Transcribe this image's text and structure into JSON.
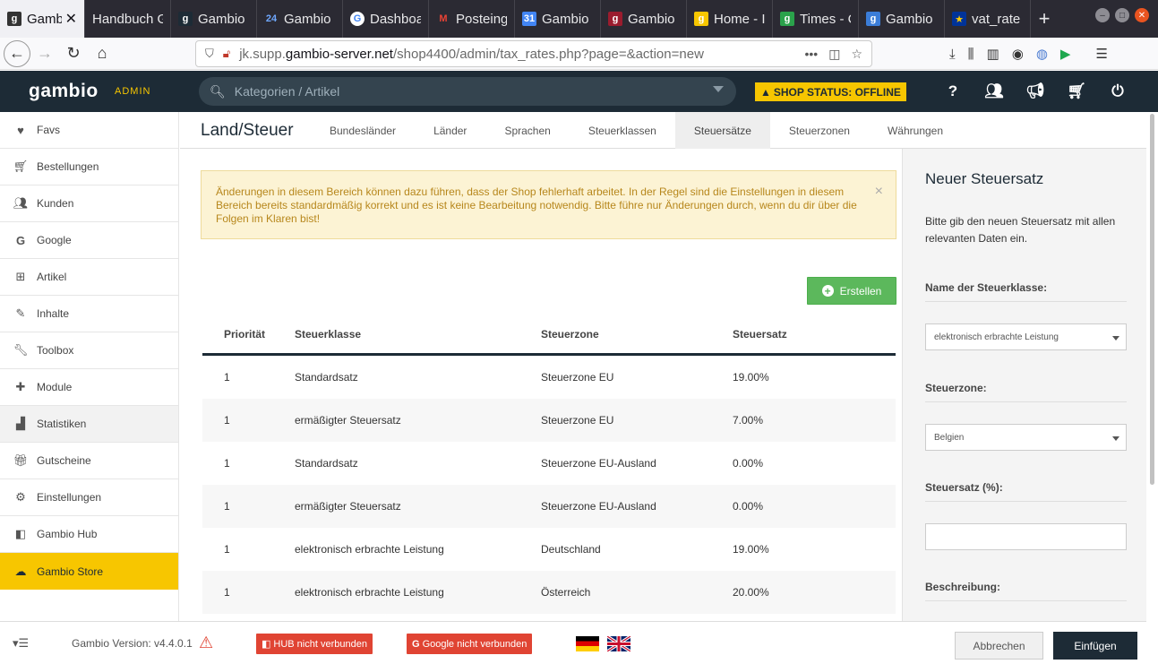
{
  "browser": {
    "tabs": [
      {
        "label": "Gambi",
        "fav": "g",
        "color": "#333"
      },
      {
        "label": "Handbuch G",
        "fav": "",
        "color": "#555"
      },
      {
        "label": "Gambio",
        "fav": "g",
        "color": "#1d2b36"
      },
      {
        "label": "Gambio",
        "fav": "24",
        "color": "#2c62b8"
      },
      {
        "label": "Dashboa",
        "fav": "G",
        "color": "#fff"
      },
      {
        "label": "Posteing",
        "fav": "M",
        "color": "#fff"
      },
      {
        "label": "Gambio",
        "fav": "31",
        "color": "#4285f4"
      },
      {
        "label": "Gambio",
        "fav": "g",
        "color": "#9b1c2e"
      },
      {
        "label": "Home - I",
        "fav": "g",
        "color": "#f7c600"
      },
      {
        "label": "Times - C",
        "fav": "g",
        "color": "#2aa24b"
      },
      {
        "label": "Gambio",
        "fav": "g",
        "color": "#3b7dd8"
      },
      {
        "label": "vat_rate",
        "fav": "★",
        "color": "#003399"
      }
    ],
    "url_prefix": "jk.supp.",
    "url_domain": "gambio-server.net",
    "url_path": "/shop4400/admin/tax_rates.php?page=&action=new",
    "url_ellipsis": "•••"
  },
  "header": {
    "logo": "gambio",
    "logo_sub": "ADMIN",
    "search_placeholder": "Kategorien / Artikel",
    "shop_status": "SHOP STATUS: OFFLINE",
    "icons": [
      "help-icon",
      "users-icon",
      "megaphone-icon",
      "cart-icon",
      "power-icon"
    ]
  },
  "sidebar": {
    "items": [
      {
        "label": "Favs",
        "icon": "♥"
      },
      {
        "label": "Bestellungen",
        "icon": "🛒"
      },
      {
        "label": "Kunden",
        "icon": "👥"
      },
      {
        "label": "Google",
        "icon": "G"
      },
      {
        "label": "Artikel",
        "icon": "⊞"
      },
      {
        "label": "Inhalte",
        "icon": "✎"
      },
      {
        "label": "Toolbox",
        "icon": "🔧"
      },
      {
        "label": "Module",
        "icon": "✚"
      },
      {
        "label": "Statistiken",
        "icon": "▟"
      },
      {
        "label": "Gutscheine",
        "icon": "🎁"
      },
      {
        "label": "Einstellungen",
        "icon": "⚙"
      },
      {
        "label": "Gambio Hub",
        "icon": "◧"
      },
      {
        "label": "Gambio Store",
        "icon": "☁"
      }
    ]
  },
  "subnav": {
    "title": "Land/Steuer",
    "tabs": [
      "Bundesländer",
      "Länder",
      "Sprachen",
      "Steuerklassen",
      "Steuersätze",
      "Steuerzonen",
      "Währungen"
    ],
    "active_tab": "Steuersätze"
  },
  "main": {
    "alert": "Änderungen in diesem Bereich können dazu führen, dass der Shop fehlerhaft arbeitet. In der Regel sind die Einstellungen in diesem Bereich bereits standardmäßig korrekt und es ist keine Bearbeitung notwendig. Bitte führe nur Änderungen durch, wenn du dir über die Folgen im Klaren bist!",
    "alert_close": "×",
    "create_button": "Erstellen",
    "table": {
      "headers": [
        "Priorität",
        "Steuerklasse",
        "Steuerzone",
        "Steuersatz"
      ],
      "rows": [
        [
          "1",
          "Standardsatz",
          "Steuerzone EU",
          "19.00%"
        ],
        [
          "1",
          "ermäßigter Steuersatz",
          "Steuerzone EU",
          "7.00%"
        ],
        [
          "1",
          "Standardsatz",
          "Steuerzone EU-Ausland",
          "0.00%"
        ],
        [
          "1",
          "ermäßigter Steuersatz",
          "Steuerzone EU-Ausland",
          "0.00%"
        ],
        [
          "1",
          "elektronisch erbrachte Leistung",
          "Deutschland",
          "19.00%"
        ],
        [
          "1",
          "elektronisch erbrachte Leistung",
          "Österreich",
          "20.00%"
        ]
      ]
    }
  },
  "panel": {
    "title": "Neuer Steuersatz",
    "description": "Bitte gib den neuen Steuersatz mit allen relevanten Daten ein.",
    "tax_class_label": "Name der Steuerklasse:",
    "tax_class_value": "elektronisch erbrachte Leistung",
    "tax_zone_label": "Steuerzone:",
    "tax_zone_value": "Belgien",
    "tax_rate_label": "Steuersatz (%):",
    "tax_rate_value": "",
    "description_label": "Beschreibung:"
  },
  "footer": {
    "menu_glyph": "▾☰",
    "version": "Gambio Version: v4.4.0.1",
    "hub_badge": "HUB nicht verbunden",
    "google_badge": "Google nicht verbunden",
    "cancel_button": "Abbrechen",
    "submit_button": "Einfügen"
  }
}
